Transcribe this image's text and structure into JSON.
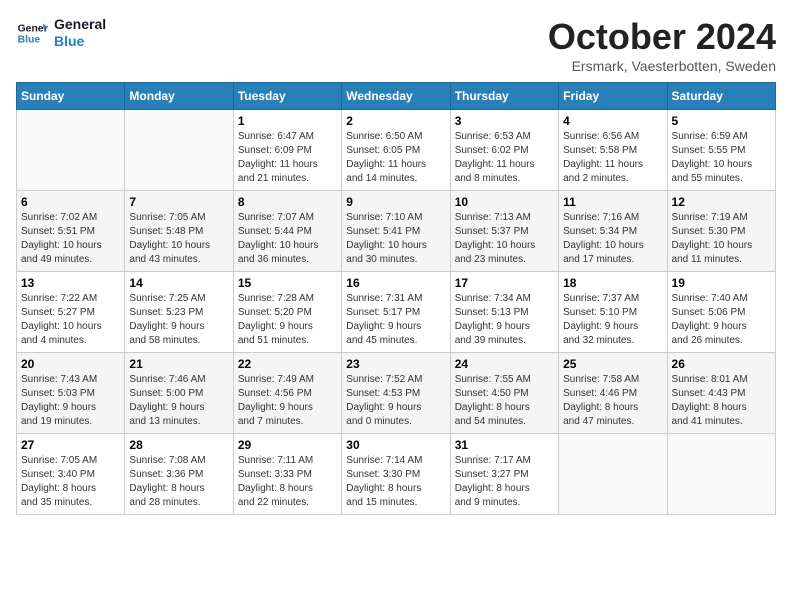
{
  "header": {
    "logo_line1": "General",
    "logo_line2": "Blue",
    "title": "October 2024",
    "subtitle": "Ersmark, Vaesterbotten, Sweden"
  },
  "weekdays": [
    "Sunday",
    "Monday",
    "Tuesday",
    "Wednesday",
    "Thursday",
    "Friday",
    "Saturday"
  ],
  "weeks": [
    [
      {
        "day": "",
        "detail": ""
      },
      {
        "day": "",
        "detail": ""
      },
      {
        "day": "1",
        "detail": "Sunrise: 6:47 AM\nSunset: 6:09 PM\nDaylight: 11 hours\nand 21 minutes."
      },
      {
        "day": "2",
        "detail": "Sunrise: 6:50 AM\nSunset: 6:05 PM\nDaylight: 11 hours\nand 14 minutes."
      },
      {
        "day": "3",
        "detail": "Sunrise: 6:53 AM\nSunset: 6:02 PM\nDaylight: 11 hours\nand 8 minutes."
      },
      {
        "day": "4",
        "detail": "Sunrise: 6:56 AM\nSunset: 5:58 PM\nDaylight: 11 hours\nand 2 minutes."
      },
      {
        "day": "5",
        "detail": "Sunrise: 6:59 AM\nSunset: 5:55 PM\nDaylight: 10 hours\nand 55 minutes."
      }
    ],
    [
      {
        "day": "6",
        "detail": "Sunrise: 7:02 AM\nSunset: 5:51 PM\nDaylight: 10 hours\nand 49 minutes."
      },
      {
        "day": "7",
        "detail": "Sunrise: 7:05 AM\nSunset: 5:48 PM\nDaylight: 10 hours\nand 43 minutes."
      },
      {
        "day": "8",
        "detail": "Sunrise: 7:07 AM\nSunset: 5:44 PM\nDaylight: 10 hours\nand 36 minutes."
      },
      {
        "day": "9",
        "detail": "Sunrise: 7:10 AM\nSunset: 5:41 PM\nDaylight: 10 hours\nand 30 minutes."
      },
      {
        "day": "10",
        "detail": "Sunrise: 7:13 AM\nSunset: 5:37 PM\nDaylight: 10 hours\nand 23 minutes."
      },
      {
        "day": "11",
        "detail": "Sunrise: 7:16 AM\nSunset: 5:34 PM\nDaylight: 10 hours\nand 17 minutes."
      },
      {
        "day": "12",
        "detail": "Sunrise: 7:19 AM\nSunset: 5:30 PM\nDaylight: 10 hours\nand 11 minutes."
      }
    ],
    [
      {
        "day": "13",
        "detail": "Sunrise: 7:22 AM\nSunset: 5:27 PM\nDaylight: 10 hours\nand 4 minutes."
      },
      {
        "day": "14",
        "detail": "Sunrise: 7:25 AM\nSunset: 5:23 PM\nDaylight: 9 hours\nand 58 minutes."
      },
      {
        "day": "15",
        "detail": "Sunrise: 7:28 AM\nSunset: 5:20 PM\nDaylight: 9 hours\nand 51 minutes."
      },
      {
        "day": "16",
        "detail": "Sunrise: 7:31 AM\nSunset: 5:17 PM\nDaylight: 9 hours\nand 45 minutes."
      },
      {
        "day": "17",
        "detail": "Sunrise: 7:34 AM\nSunset: 5:13 PM\nDaylight: 9 hours\nand 39 minutes."
      },
      {
        "day": "18",
        "detail": "Sunrise: 7:37 AM\nSunset: 5:10 PM\nDaylight: 9 hours\nand 32 minutes."
      },
      {
        "day": "19",
        "detail": "Sunrise: 7:40 AM\nSunset: 5:06 PM\nDaylight: 9 hours\nand 26 minutes."
      }
    ],
    [
      {
        "day": "20",
        "detail": "Sunrise: 7:43 AM\nSunset: 5:03 PM\nDaylight: 9 hours\nand 19 minutes."
      },
      {
        "day": "21",
        "detail": "Sunrise: 7:46 AM\nSunset: 5:00 PM\nDaylight: 9 hours\nand 13 minutes."
      },
      {
        "day": "22",
        "detail": "Sunrise: 7:49 AM\nSunset: 4:56 PM\nDaylight: 9 hours\nand 7 minutes."
      },
      {
        "day": "23",
        "detail": "Sunrise: 7:52 AM\nSunset: 4:53 PM\nDaylight: 9 hours\nand 0 minutes."
      },
      {
        "day": "24",
        "detail": "Sunrise: 7:55 AM\nSunset: 4:50 PM\nDaylight: 8 hours\nand 54 minutes."
      },
      {
        "day": "25",
        "detail": "Sunrise: 7:58 AM\nSunset: 4:46 PM\nDaylight: 8 hours\nand 47 minutes."
      },
      {
        "day": "26",
        "detail": "Sunrise: 8:01 AM\nSunset: 4:43 PM\nDaylight: 8 hours\nand 41 minutes."
      }
    ],
    [
      {
        "day": "27",
        "detail": "Sunrise: 7:05 AM\nSunset: 3:40 PM\nDaylight: 8 hours\nand 35 minutes."
      },
      {
        "day": "28",
        "detail": "Sunrise: 7:08 AM\nSunset: 3:36 PM\nDaylight: 8 hours\nand 28 minutes."
      },
      {
        "day": "29",
        "detail": "Sunrise: 7:11 AM\nSunset: 3:33 PM\nDaylight: 8 hours\nand 22 minutes."
      },
      {
        "day": "30",
        "detail": "Sunrise: 7:14 AM\nSunset: 3:30 PM\nDaylight: 8 hours\nand 15 minutes."
      },
      {
        "day": "31",
        "detail": "Sunrise: 7:17 AM\nSunset: 3:27 PM\nDaylight: 8 hours\nand 9 minutes."
      },
      {
        "day": "",
        "detail": ""
      },
      {
        "day": "",
        "detail": ""
      }
    ]
  ]
}
